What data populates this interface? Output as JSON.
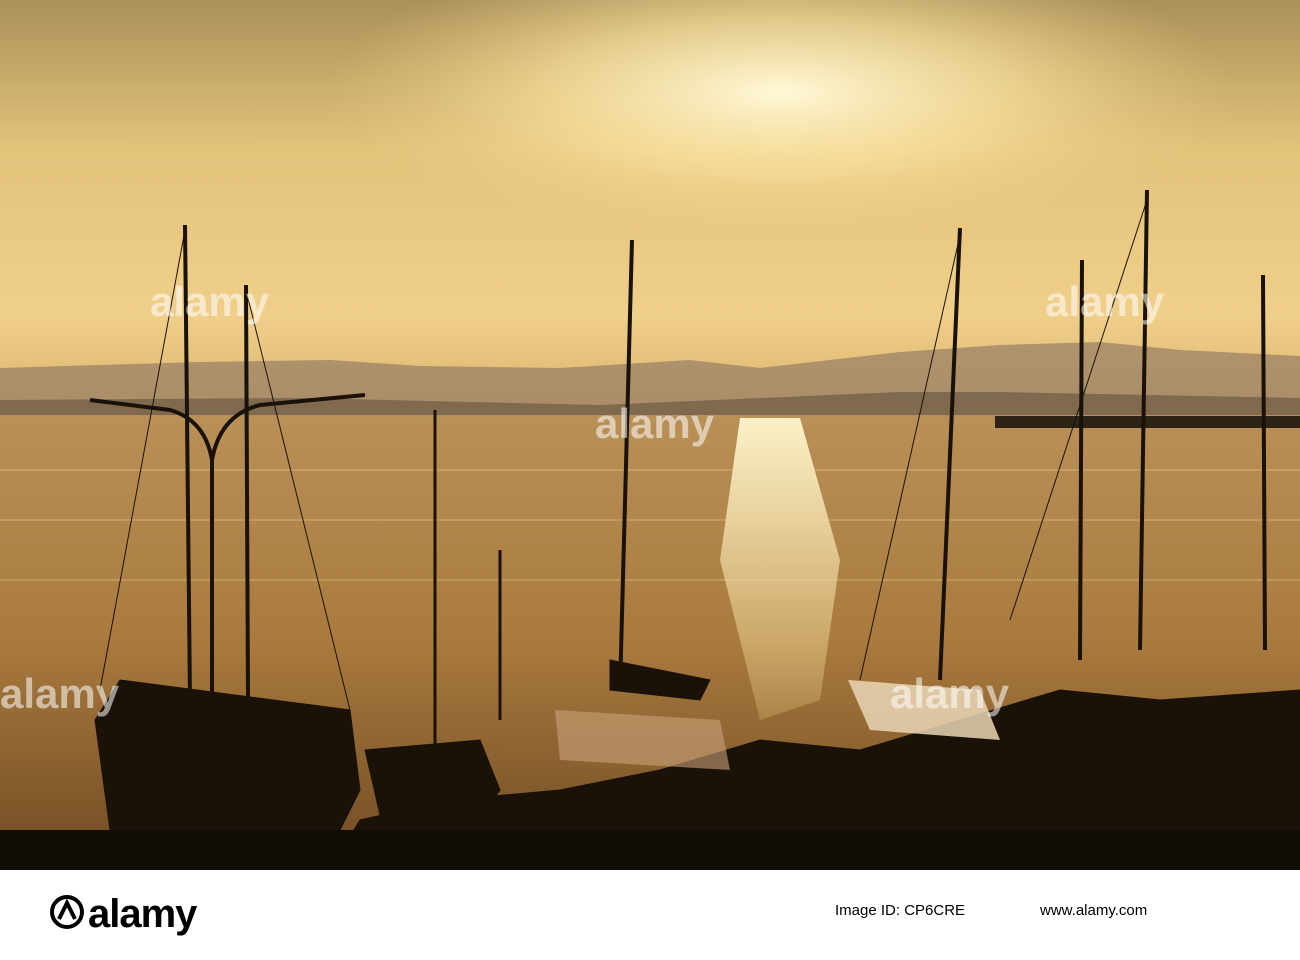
{
  "photo": {
    "description_icon": "sunset-harbor-sailboats",
    "sky_top": "#b49a5c",
    "sky_glow": "#fff2c0",
    "water": "#c79a52",
    "silhouette": "#1a1209"
  },
  "watermark": {
    "text": "alamy"
  },
  "footer": {
    "logo_text": "alamy",
    "image_id": "Image ID: CP6CRE",
    "site": "www.alamy.com"
  }
}
